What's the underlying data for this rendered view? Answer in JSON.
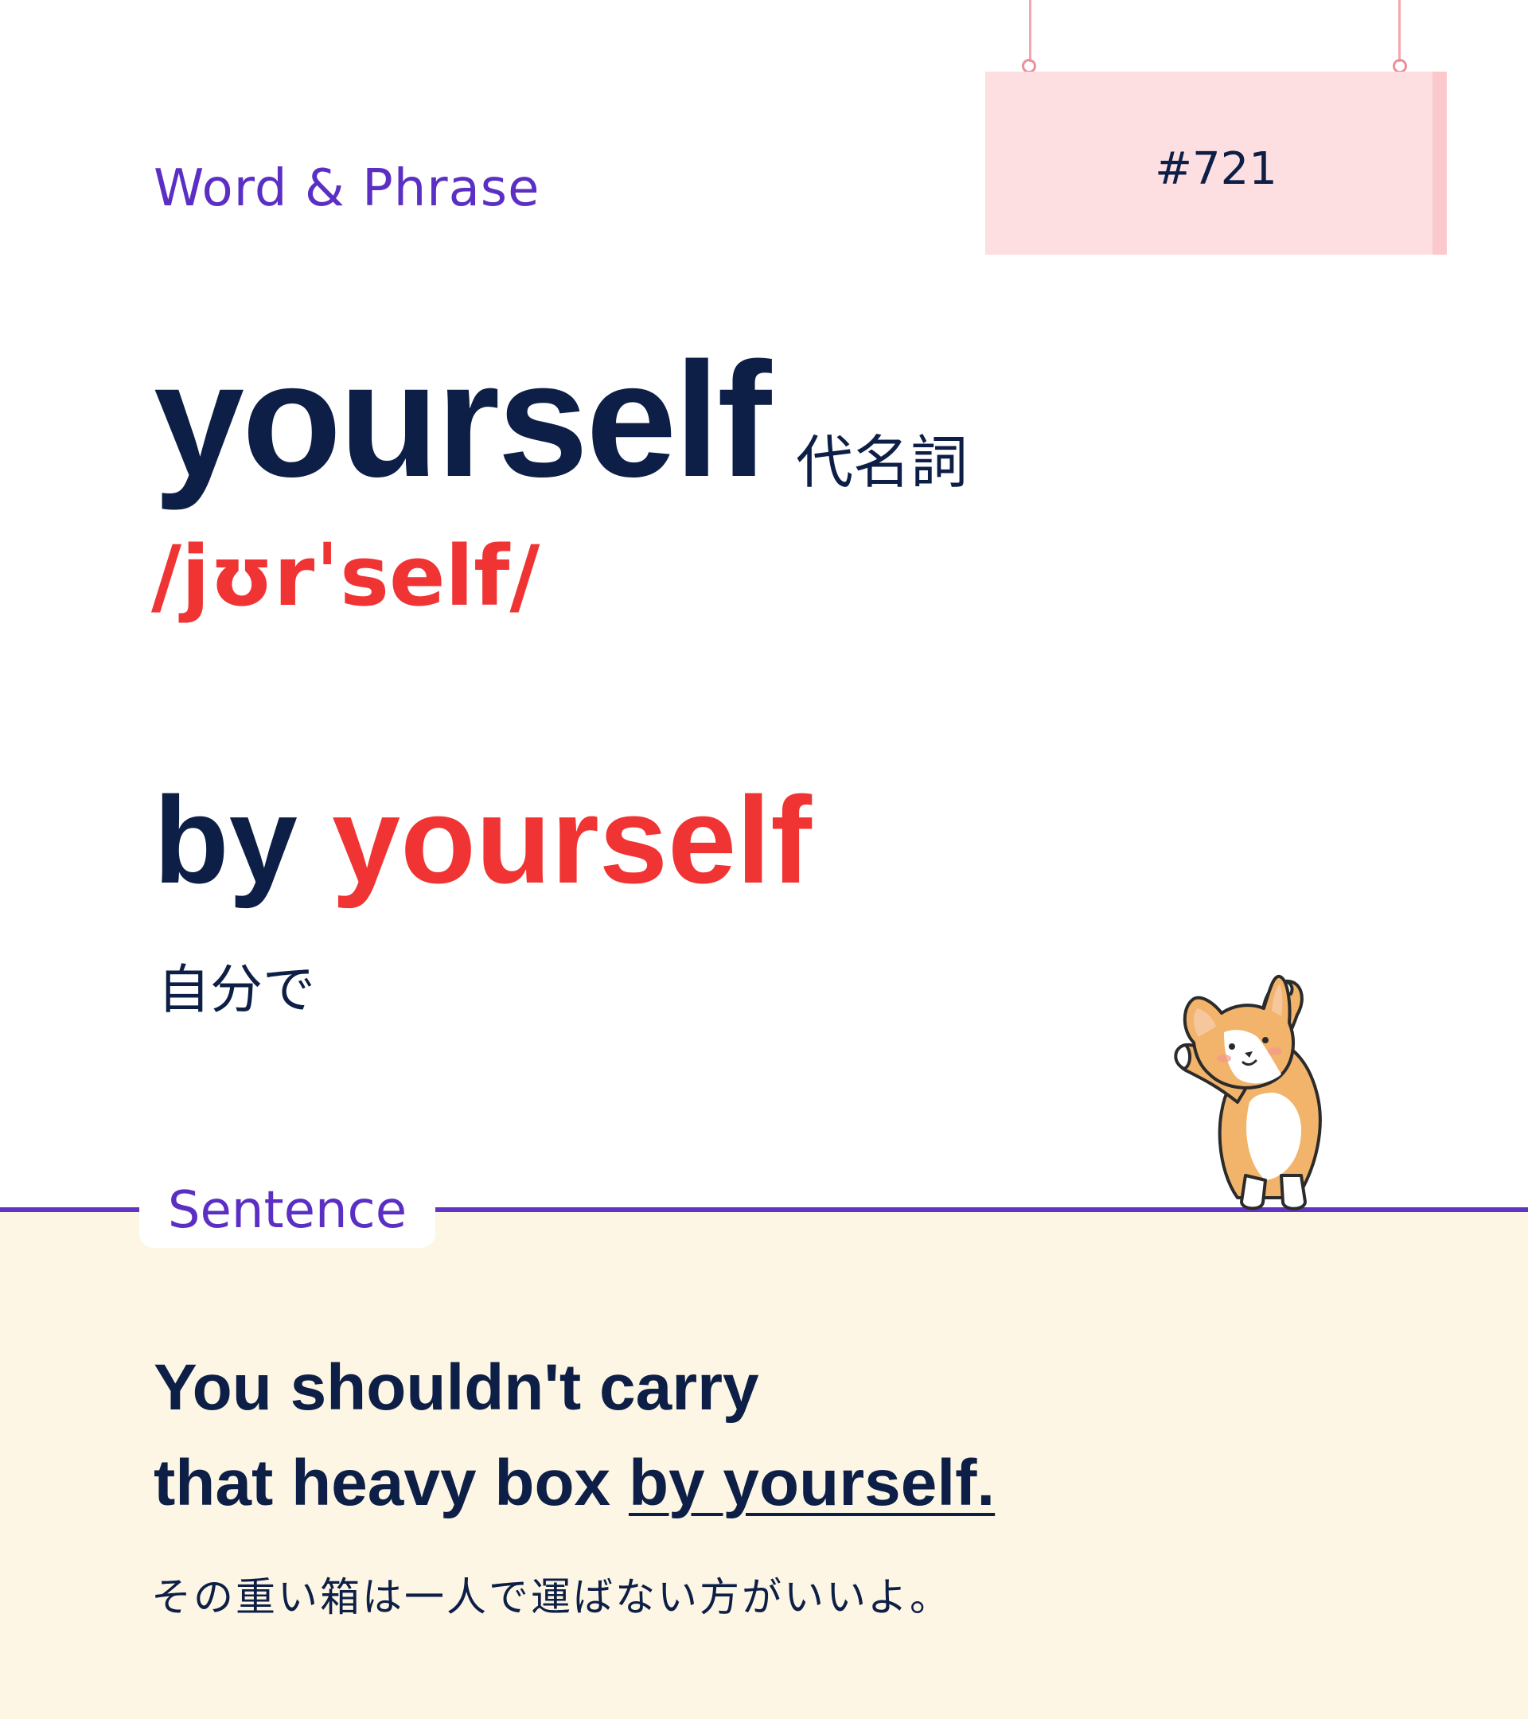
{
  "header": {
    "category": "Word & Phrase",
    "card_number": "#721"
  },
  "entry": {
    "word": "yourself",
    "part_of_speech": "代名詞",
    "pronunciation": "/jʊrˈself/"
  },
  "phrase": {
    "prefix": "by ",
    "highlight": "yourself",
    "meaning": "自分で"
  },
  "sentence": {
    "section_label": "Sentence",
    "line1": "You shouldn't carry",
    "line2_prefix": "that heavy box ",
    "line2_underlined": "by yourself.",
    "translation": "その重い箱は一人で運ばない方がいいよ。"
  },
  "mascot": {
    "icon": "corgi-stretching-icon"
  },
  "colors": {
    "navy": "#0d1f46",
    "accent_red": "#f03434",
    "purple": "#5b2fc4",
    "sign_pink": "#fddfe2",
    "bottom_cream": "#fdf6e4"
  }
}
